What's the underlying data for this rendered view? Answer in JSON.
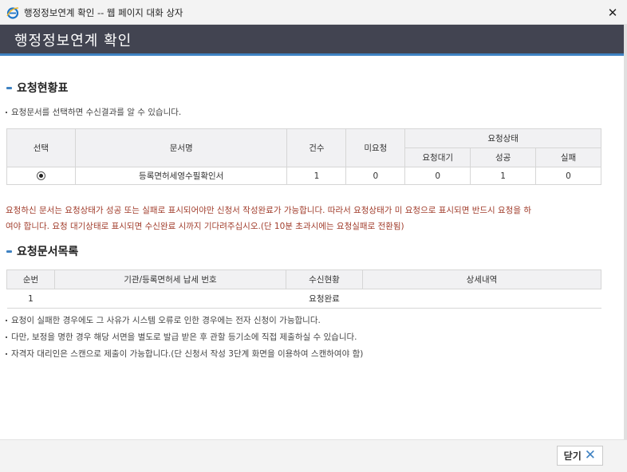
{
  "window": {
    "title": "행정정보연계 확인 -- 웹 페이지 대화 상자",
    "close_glyph": "✕"
  },
  "header": {
    "title": "행정정보연계 확인"
  },
  "request_status": {
    "title": "요청현황표",
    "note": "요청문서를 선택하면 수신결과를 알 수 있습니다.",
    "columns": {
      "select": "선택",
      "doc_name": "문서명",
      "count": "건수",
      "not_requested": "미요청",
      "request_state": "요청상태",
      "waiting": "요청대기",
      "success": "성공",
      "fail": "실패"
    },
    "rows": [
      {
        "doc_name": "등록면허세영수필확인서",
        "count": "1",
        "not_requested": "0",
        "waiting": "0",
        "success": "1",
        "fail": "0",
        "selected": true
      }
    ]
  },
  "warning": {
    "line1": "요청하신 문서는 요청상태가 성공 또는 실패로 표시되어야만 신청서 작성완료가 가능합니다. 따라서 요청상태가 미 요청으로 표시되면 반드시 요청을 하",
    "line2": "여야 합니다. 요청 대기상태로 표시되면 수신완료 시까지 기다려주십시오.(단 10분 초과시에는 요청실패로 전환됨)"
  },
  "request_docs": {
    "title": "요청문서목록",
    "columns": {
      "seq": "순번",
      "agency": "기관/등록면허세 납세 번호",
      "received": "수신현황",
      "detail": "상세내역"
    },
    "rows": [
      {
        "seq": "1",
        "agency": "",
        "received": "요청완료",
        "detail": ""
      }
    ]
  },
  "notes": [
    "요청이 실패한 경우에도 그 사유가 시스템 오류로 인한 경우에는 전자 신청이 가능합니다.",
    "다만, 보정을 명한 경우 해당 서면을 별도로 발급 받은 후 관할 등기소에 직접 제출하실 수 있습니다.",
    "자격자 대리인은 스캔으로 제출이 가능합니다.(단 신청서 작성 3단계 화면을 이용하여 스캔하여야 함)"
  ],
  "footer": {
    "close_label": "닫기",
    "close_icon": "✕"
  },
  "colors": {
    "header_bg": "#424451",
    "accent": "#3f82c2",
    "warning": "#a13d2c"
  }
}
